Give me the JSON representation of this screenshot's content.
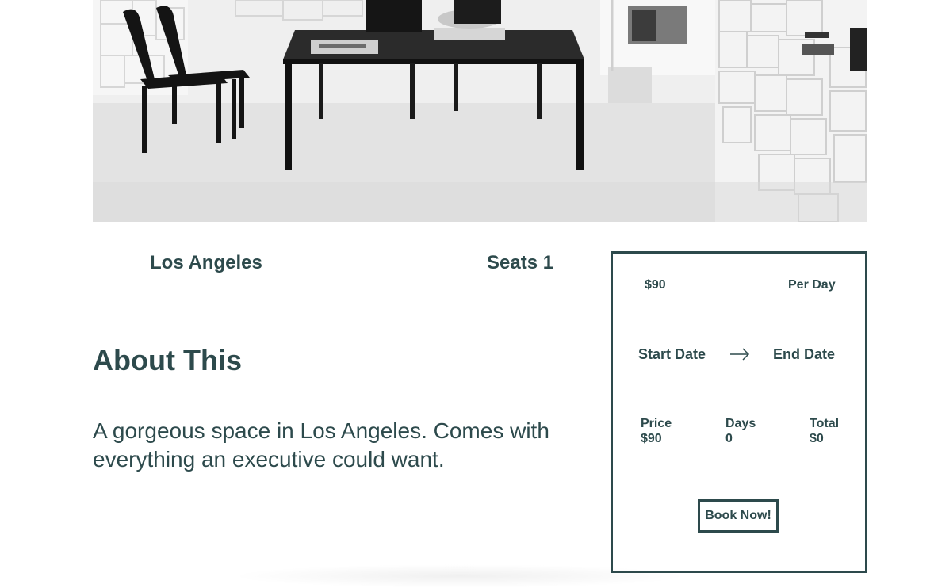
{
  "listing": {
    "location": "Los Angeles",
    "seats": "Seats 1"
  },
  "about": {
    "title": "About This",
    "description": "A gorgeous space in Los Angeles. Comes with everything an executive could want."
  },
  "booking": {
    "price": "$90",
    "rate_unit": "Per Day",
    "start_date": "Start Date",
    "end_date": "End Date",
    "summary": {
      "price_label": "Price",
      "price_value": "$90",
      "days_label": "Days",
      "days_value": "0",
      "total_label": "Total",
      "total_value": "$0"
    },
    "book_button": "Book Now!"
  },
  "icons": {
    "date_arrow": "arrow-right-icon"
  },
  "colors": {
    "text": "#2d4a4c",
    "border": "#2d4a4c",
    "background": "#ffffff"
  }
}
